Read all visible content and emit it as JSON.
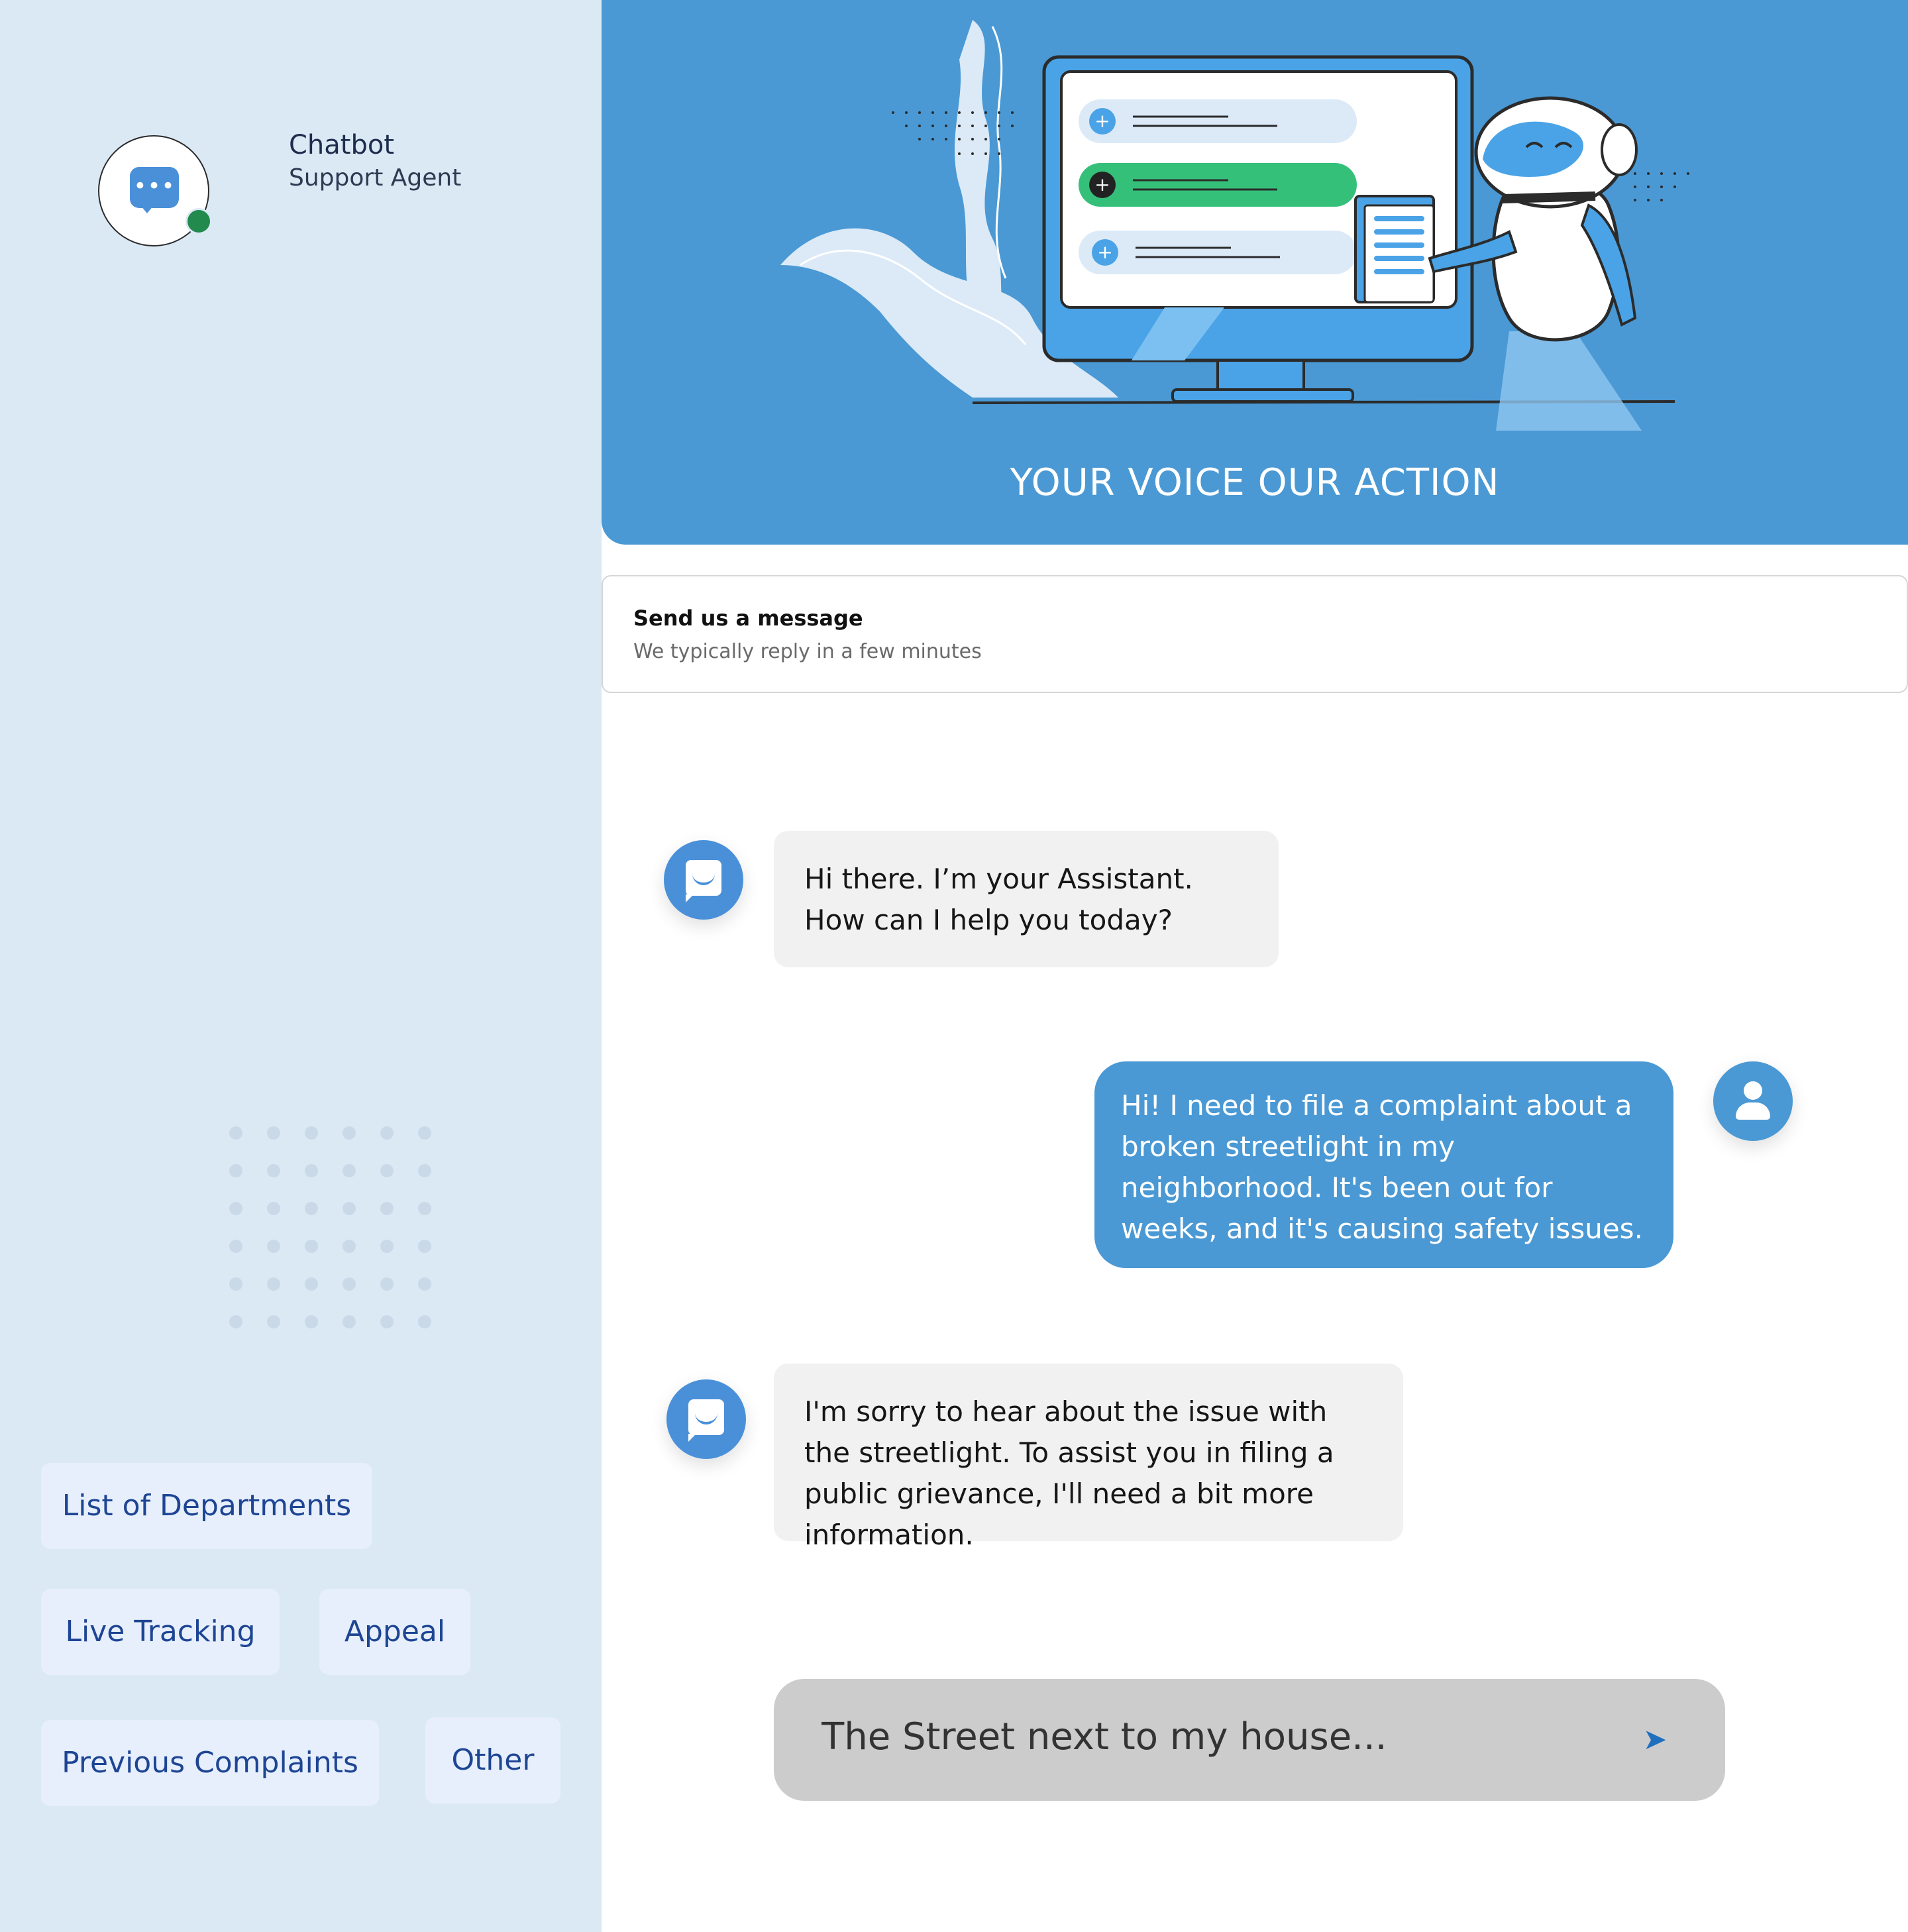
{
  "agent": {
    "name": "Chatbot",
    "role": "Support Agent",
    "status_color": "#218a4c"
  },
  "hero": {
    "title": "YOUR VOICE OUR ACTION"
  },
  "message_card": {
    "title": "Send us a message",
    "subtitle": "We typically reply in a few minutes"
  },
  "chat": {
    "messages": [
      {
        "sender": "bot",
        "text": "Hi there. I’m your Assistant. How can I help you today?"
      },
      {
        "sender": "user",
        "text": "Hi! I need to file a complaint about a broken streetlight in my neighborhood. It's been out for weeks, and it's causing safety issues."
      },
      {
        "sender": "bot",
        "text": "I'm sorry to hear about the issue with the streetlight. To assist you in filing a public grievance, I'll need a bit more information."
      }
    ]
  },
  "composer": {
    "value": "The Street next to my house..."
  },
  "quick_replies": {
    "departments": "List of Departments",
    "live_tracking": "Live Tracking",
    "appeal": "Appeal",
    "previous": "Previous Complaints",
    "other": "Other"
  },
  "colors": {
    "primary": "#4a99d4",
    "sidebar": "#dbe9f5",
    "chip_text": "#1e4594",
    "bot_bubble": "#f1f1f1"
  },
  "icons": [
    "chat-bubble-icon",
    "bot-face-icon",
    "user-icon",
    "send-icon"
  ]
}
